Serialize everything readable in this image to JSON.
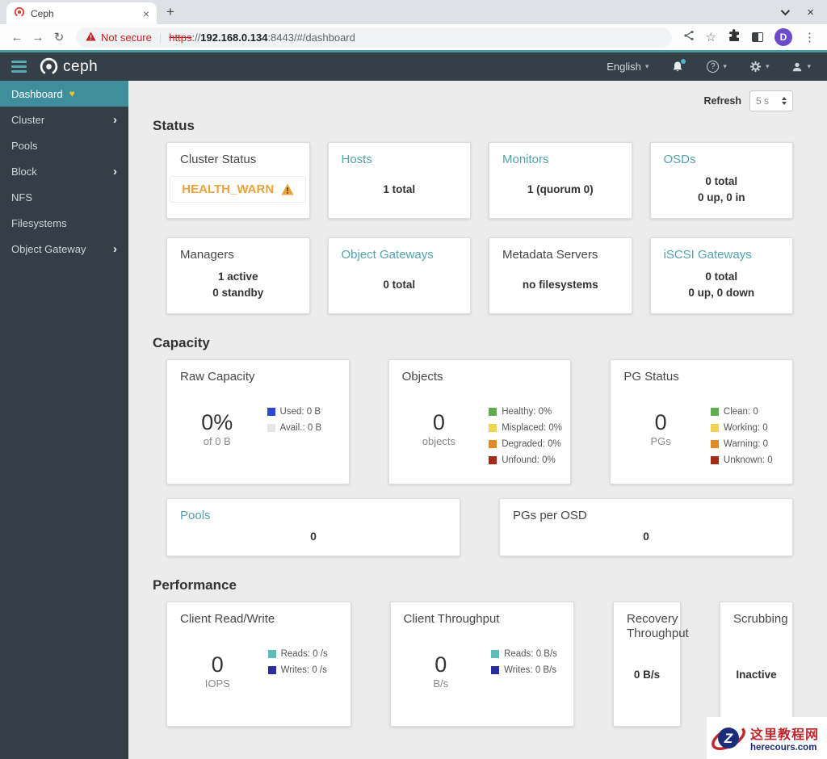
{
  "browser": {
    "tab_title": "Ceph",
    "tab_close": "×",
    "new_tab_button": "+",
    "win_close": "×",
    "back": "←",
    "forward": "→",
    "reload": "↻",
    "not_secure": "Not secure",
    "url_divider": "|",
    "scheme": "https",
    "scheme_sep": "://",
    "host": "192.168.0.134",
    "path": ":8443/#/dashboard",
    "star": "☆",
    "avatar_initial": "D",
    "menu_dots": "⋮"
  },
  "app_header": {
    "brand": "ceph",
    "language": "English",
    "caret": "▾",
    "help_glyph": "?"
  },
  "sidebar": {
    "items": [
      {
        "label": "Dashboard"
      },
      {
        "label": "Cluster",
        "chevron": "›"
      },
      {
        "label": "Pools"
      },
      {
        "label": "Block",
        "chevron": "›"
      },
      {
        "label": "NFS"
      },
      {
        "label": "Filesystems"
      },
      {
        "label": "Object Gateway",
        "chevron": "›"
      }
    ],
    "health_heart": "♥"
  },
  "main": {
    "refresh_label": "Refresh",
    "refresh_value": "5 s",
    "status": {
      "heading": "Status",
      "cluster_status": {
        "title": "Cluster Status",
        "health": "HEALTH_WARN"
      },
      "hosts": {
        "title": "Hosts",
        "line1": "1 total"
      },
      "monitors": {
        "title": "Monitors",
        "line1": "1 (quorum 0)"
      },
      "osds": {
        "title": "OSDs",
        "line1": "0 total",
        "line2": "0 up, 0 in"
      },
      "managers": {
        "title": "Managers",
        "line1": "1 active",
        "line2": "0 standby"
      },
      "object_gateways": {
        "title": "Object Gateways",
        "line1": "0 total"
      },
      "metadata_servers": {
        "title": "Metadata Servers",
        "line1": "no filesystems"
      },
      "iscsi_gateways": {
        "title": "iSCSI Gateways",
        "line1": "0 total",
        "line2": "0 up, 0 down"
      }
    },
    "capacity": {
      "heading": "Capacity",
      "raw": {
        "title": "Raw Capacity",
        "value": "0%",
        "sub": "of 0 B",
        "legend": [
          {
            "label": "Used: 0 B",
            "color": "#2b48d8"
          },
          {
            "label": "Avail.: 0 B",
            "color": "#e6e6e6"
          }
        ]
      },
      "objects": {
        "title": "Objects",
        "value": "0",
        "sub": "objects",
        "legend": [
          {
            "label": "Healthy: 0%",
            "color": "#60ad51"
          },
          {
            "label": "Misplaced: 0%",
            "color": "#efd453"
          },
          {
            "label": "Degraded: 0%",
            "color": "#e08a2a"
          },
          {
            "label": "Unfound: 0%",
            "color": "#a52c1b"
          }
        ]
      },
      "pg_status": {
        "title": "PG Status",
        "value": "0",
        "sub": "PGs",
        "legend": [
          {
            "label": "Clean: 0",
            "color": "#60ad51"
          },
          {
            "label": "Working: 0",
            "color": "#efd453"
          },
          {
            "label": "Warning: 0",
            "color": "#e08a2a"
          },
          {
            "label": "Unknown: 0",
            "color": "#a52c1b"
          }
        ]
      },
      "pools": {
        "title": "Pools",
        "value": "0"
      },
      "pgs_per_osd": {
        "title": "PGs per OSD",
        "value": "0"
      }
    },
    "performance": {
      "heading": "Performance",
      "client_rw": {
        "title": "Client Read/Write",
        "value": "0",
        "sub": "IOPS",
        "legend": [
          {
            "label": "Reads: 0 /s",
            "color": "#5bbcba"
          },
          {
            "label": "Writes: 0 /s",
            "color": "#2c2d9c"
          }
        ]
      },
      "client_tp": {
        "title": "Client Throughput",
        "value": "0",
        "sub": "B/s",
        "legend": [
          {
            "label": "Reads: 0 B/s",
            "color": "#5bbcba"
          },
          {
            "label": "Writes: 0 B/s",
            "color": "#2c2d9c"
          }
        ]
      },
      "recovery": {
        "title": "Recovery Throughput",
        "value": "0 B/s"
      },
      "scrubbing": {
        "title": "Scrubbing",
        "value": "Inactive"
      }
    }
  },
  "watermark": {
    "zh": "这里教程网",
    "en": "herecours.com",
    "letter": "Z"
  },
  "colors": {
    "accent_teal": "#52a3ad",
    "health_warn": "#eaa43c",
    "header_bg": "#343f48",
    "sidebar_active": "#3f8e9c"
  }
}
